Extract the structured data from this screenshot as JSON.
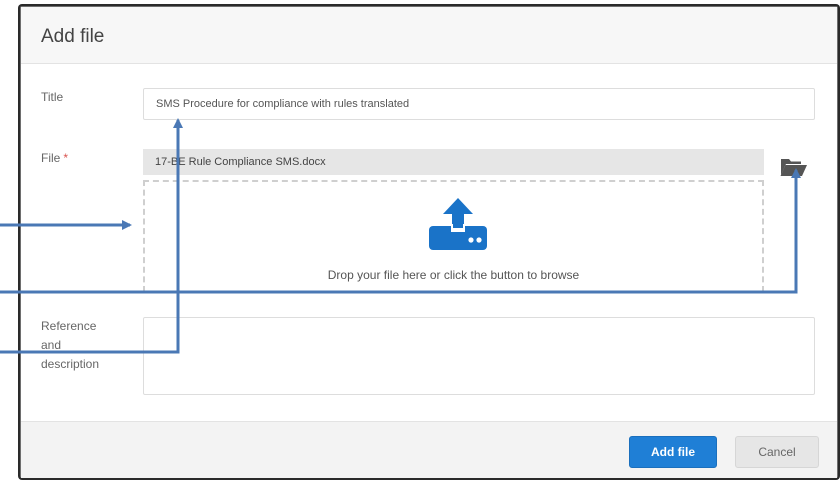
{
  "dialog": {
    "title": "Add file",
    "title_field": {
      "label": "Title",
      "value": "SMS Procedure for compliance with rules translated"
    },
    "file_field": {
      "label": "File",
      "required_mark": "*",
      "file_name": "17-BE Rule Compliance SMS.docx",
      "browse_icon": "folder-open-icon",
      "upload_icon": "upload-icon",
      "dropzone_text": "Drop your file here or click the button to browse"
    },
    "description_field": {
      "label_lines": [
        "Reference",
        "and",
        "description"
      ],
      "value": ""
    },
    "footer": {
      "add_label": "Add file",
      "cancel_label": "Cancel"
    }
  },
  "colors": {
    "primary": "#1f7fd6",
    "upload_icon": "#1a73c8",
    "annotation_arrow": "#4a78b5"
  }
}
